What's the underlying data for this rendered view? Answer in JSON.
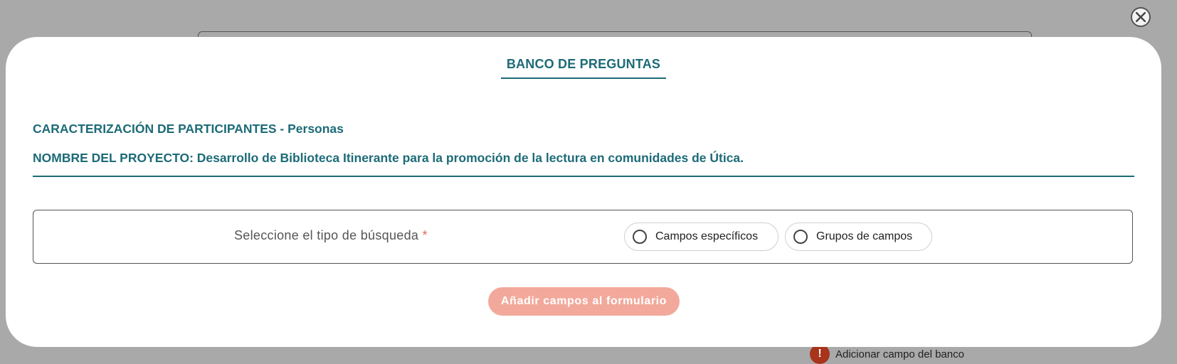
{
  "modal": {
    "title": "BANCO DE PREGUNTAS",
    "characterization": "CARACTERIZACIÓN DE PARTICIPANTES - Personas",
    "project": "NOMBRE DEL PROYECTO: Desarrollo de Biblioteca Itinerante para la promoción de la lectura en comunidades de Útica.",
    "close_icon": "close-icon"
  },
  "search": {
    "label": "Seleccione el tipo de búsqueda",
    "required_mark": "*",
    "options": [
      {
        "label": "Campos específicos",
        "selected": false
      },
      {
        "label": "Grupos de campos",
        "selected": false
      }
    ]
  },
  "actions": {
    "add_fields_label": "Añadir campos al formulario"
  },
  "background": {
    "action_label": "Adicionar campo del banco",
    "action_icon_glyph": "!"
  },
  "colors": {
    "accent": "#1d6b78",
    "button_disabled": "#f2a99b",
    "required": "#e06a5a",
    "overlay": "#a9a9a9"
  }
}
